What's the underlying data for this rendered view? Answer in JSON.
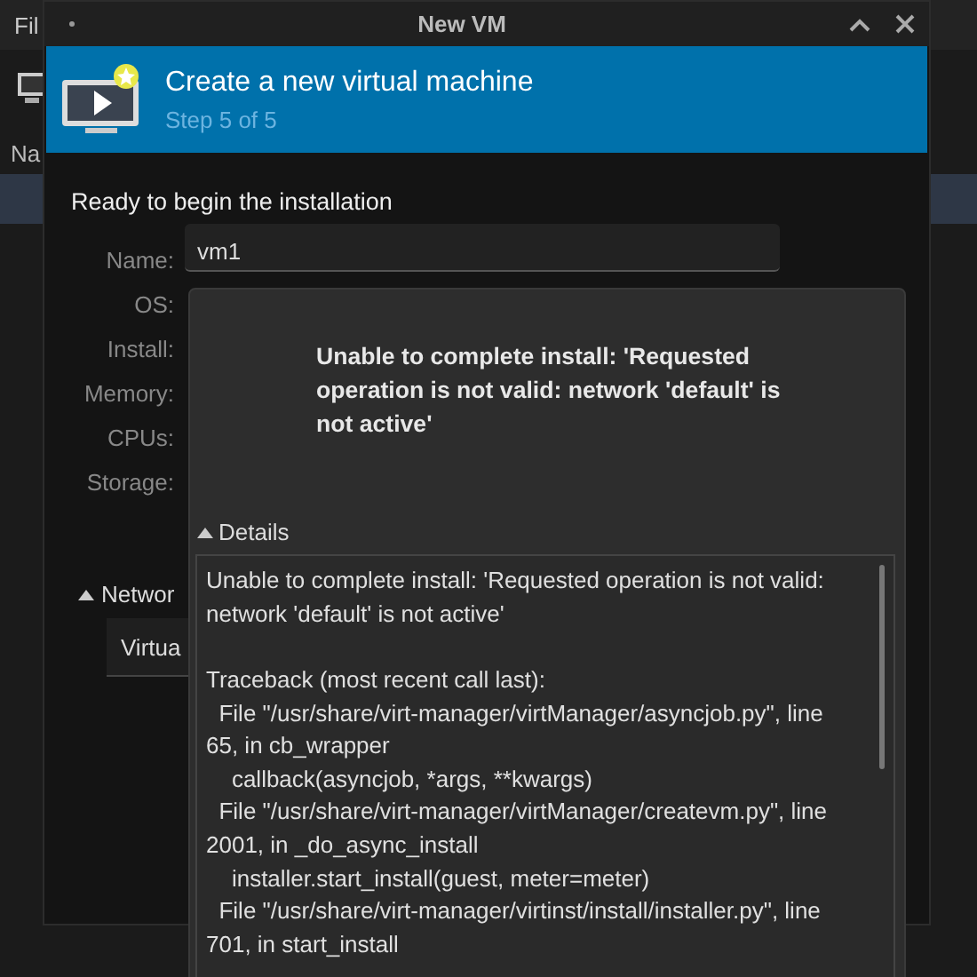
{
  "background_window": {
    "menu": "Fil",
    "column_header": "Na"
  },
  "dialog": {
    "title": "New VM",
    "header": {
      "title": "Create a new virtual machine",
      "subtitle": "Step 5 of 5"
    },
    "summary_heading": "Ready to begin the installation",
    "fields": [
      {
        "label": "Name:",
        "value": "vm1"
      },
      {
        "label": "OS:"
      },
      {
        "label": "Install:"
      },
      {
        "label": "Memory:"
      },
      {
        "label": "CPUs:"
      },
      {
        "label": "Storage:"
      }
    ],
    "network": {
      "label": "Networ",
      "expanded": true,
      "selection": "Virtua"
    }
  },
  "error_dialog": {
    "message": "Unable to complete install: 'Requested operation is not valid: network 'default' is not active'",
    "details": {
      "label": "Details",
      "expanded": true,
      "paragraphs": [
        [
          "Unable to complete install: 'Requested operation is not valid:",
          "network 'default' is not active'"
        ],
        [
          "Traceback (most recent call last):",
          "  File \"/usr/share/virt-manager/virtManager/asyncjob.py\", line",
          "65, in cb_wrapper",
          "    callback(asyncjob, *args, **kwargs)",
          "  File \"/usr/share/virt-manager/virtManager/createvm.py\", line",
          "2001, in _do_async_install",
          "    installer.start_install(guest, meter=meter)",
          "  File \"/usr/share/virt-manager/virtinst/install/installer.py\", line",
          "701, in start_install"
        ]
      ]
    }
  }
}
